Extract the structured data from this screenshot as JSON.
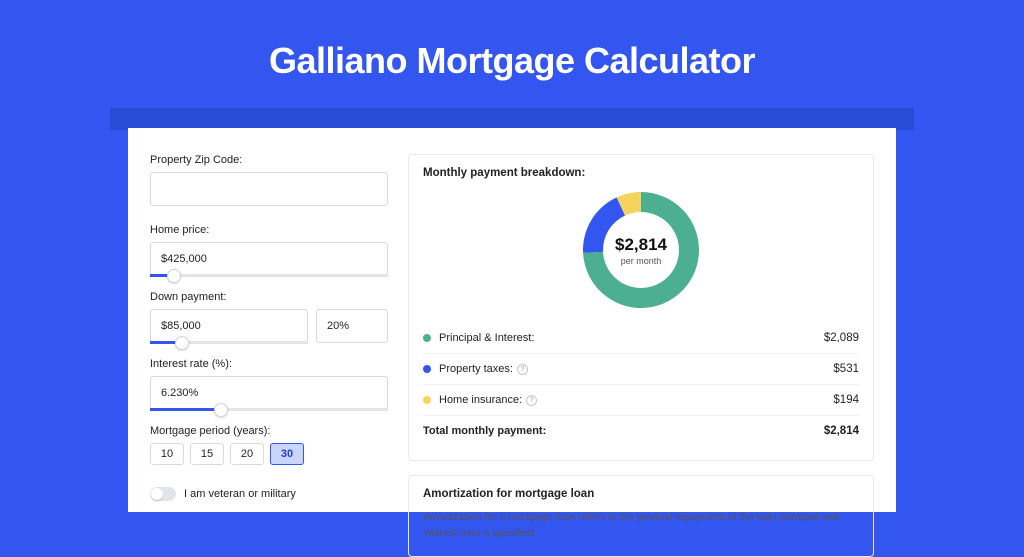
{
  "title": "Galliano Mortgage Calculator",
  "colors": {
    "green": "#4caf91",
    "blue": "#3355f0",
    "yellow": "#f4d35e"
  },
  "form": {
    "zip_label": "Property Zip Code:",
    "zip_value": "",
    "home_price_label": "Home price:",
    "home_price_value": "$425,000",
    "home_price_slider_pct": 10,
    "down_label": "Down payment:",
    "down_amount_value": "$85,000",
    "down_pct_value": "20%",
    "down_slider_pct": 20,
    "rate_label": "Interest rate (%):",
    "rate_value": "6.230%",
    "rate_slider_pct": 30,
    "period_label": "Mortgage period (years):",
    "periods": [
      "10",
      "15",
      "20",
      "30"
    ],
    "period_selected": "30",
    "veteran_label": "I am veteran or military"
  },
  "breakdown": {
    "title": "Monthly payment breakdown:",
    "center_amount": "$2,814",
    "center_sub": "per month",
    "items": [
      {
        "label": "Principal & Interest:",
        "value": "$2,089",
        "color": "#4caf91",
        "info": false
      },
      {
        "label": "Property taxes:",
        "value": "$531",
        "color": "#3355f0",
        "info": true
      },
      {
        "label": "Home insurance:",
        "value": "$194",
        "color": "#f4d35e",
        "info": true
      }
    ],
    "total_label": "Total monthly payment:",
    "total_value": "$2,814"
  },
  "chart_data": {
    "type": "pie",
    "title": "Monthly payment breakdown",
    "series": [
      {
        "name": "Principal & Interest",
        "value": 2089,
        "color": "#4caf91"
      },
      {
        "name": "Property taxes",
        "value": 531,
        "color": "#3355f0"
      },
      {
        "name": "Home insurance",
        "value": 194,
        "color": "#f4d35e"
      }
    ],
    "total": 2814,
    "center_label": "$2,814 per month"
  },
  "amort": {
    "title": "Amortization for mortgage loan",
    "text": "Amortization for a mortgage loan refers to the gradual repayment of the loan principal and interest over a specified"
  }
}
